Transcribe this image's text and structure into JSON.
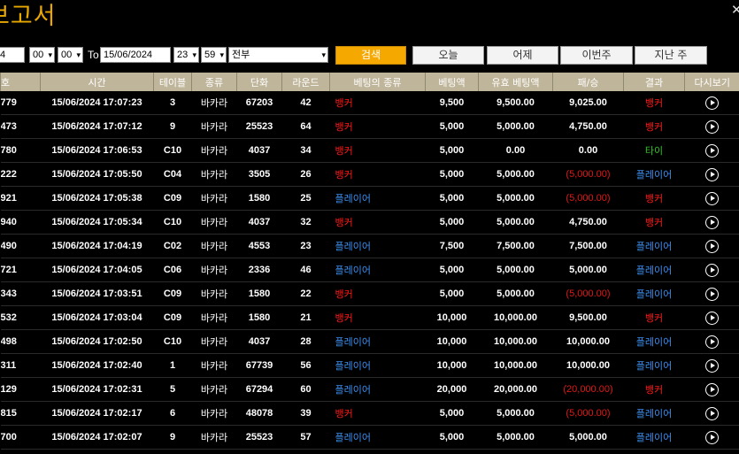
{
  "page": {
    "title": "보고서",
    "close_glyph": "✕"
  },
  "filter": {
    "from_date": "4",
    "from_hour": "00",
    "from_min": "00",
    "to_label": "To",
    "to_date": "15/06/2024",
    "to_hour": "23",
    "to_min": "59",
    "type_select": "전부",
    "search_label": "검색",
    "today_label": "오늘",
    "yesterday_label": "어제",
    "this_week_label": "이번주",
    "last_week_label": "지난 주"
  },
  "table": {
    "headers": [
      "호",
      "시간",
      "테이블",
      "종류",
      "단화",
      "라운드",
      "베팅의 종류",
      "베팅액",
      "유효 베팅액",
      "패/승",
      "결과",
      "다시보기"
    ],
    "rows": [
      {
        "id": "779",
        "time": "15/06/2024 17:07:23",
        "table": "3",
        "kind": "바카라",
        "shoe": "67203",
        "round": "42",
        "bet_type": "뱅커",
        "bet_color": "red",
        "bet": "9,500",
        "valid": "9,500.00",
        "winloss": "9,025.00",
        "winloss_neg": false,
        "result": "뱅커",
        "result_color": "red"
      },
      {
        "id": "473",
        "time": "15/06/2024 17:07:12",
        "table": "9",
        "kind": "바카라",
        "shoe": "25523",
        "round": "64",
        "bet_type": "뱅커",
        "bet_color": "red",
        "bet": "5,000",
        "valid": "5,000.00",
        "winloss": "4,750.00",
        "winloss_neg": false,
        "result": "뱅커",
        "result_color": "red"
      },
      {
        "id": "780",
        "time": "15/06/2024 17:06:53",
        "table": "C10",
        "kind": "바카라",
        "shoe": "4037",
        "round": "34",
        "bet_type": "뱅커",
        "bet_color": "red",
        "bet": "5,000",
        "valid": "0.00",
        "winloss": "0.00",
        "winloss_neg": false,
        "result": "타이",
        "result_color": "green"
      },
      {
        "id": "222",
        "time": "15/06/2024 17:05:50",
        "table": "C04",
        "kind": "바카라",
        "shoe": "3505",
        "round": "26",
        "bet_type": "뱅커",
        "bet_color": "red",
        "bet": "5,000",
        "valid": "5,000.00",
        "winloss": "(5,000.00)",
        "winloss_neg": true,
        "result": "플레이어",
        "result_color": "blue"
      },
      {
        "id": "921",
        "time": "15/06/2024 17:05:38",
        "table": "C09",
        "kind": "바카라",
        "shoe": "1580",
        "round": "25",
        "bet_type": "플레이어",
        "bet_color": "blue",
        "bet": "5,000",
        "valid": "5,000.00",
        "winloss": "(5,000.00)",
        "winloss_neg": true,
        "result": "뱅커",
        "result_color": "red"
      },
      {
        "id": "940",
        "time": "15/06/2024 17:05:34",
        "table": "C10",
        "kind": "바카라",
        "shoe": "4037",
        "round": "32",
        "bet_type": "뱅커",
        "bet_color": "red",
        "bet": "5,000",
        "valid": "5,000.00",
        "winloss": "4,750.00",
        "winloss_neg": false,
        "result": "뱅커",
        "result_color": "red"
      },
      {
        "id": "490",
        "time": "15/06/2024 17:04:19",
        "table": "C02",
        "kind": "바카라",
        "shoe": "4553",
        "round": "23",
        "bet_type": "플레이어",
        "bet_color": "blue",
        "bet": "7,500",
        "valid": "7,500.00",
        "winloss": "7,500.00",
        "winloss_neg": false,
        "result": "플레이어",
        "result_color": "blue"
      },
      {
        "id": "721",
        "time": "15/06/2024 17:04:05",
        "table": "C06",
        "kind": "바카라",
        "shoe": "2336",
        "round": "46",
        "bet_type": "플레이어",
        "bet_color": "blue",
        "bet": "5,000",
        "valid": "5,000.00",
        "winloss": "5,000.00",
        "winloss_neg": false,
        "result": "플레이어",
        "result_color": "blue"
      },
      {
        "id": "343",
        "time": "15/06/2024 17:03:51",
        "table": "C09",
        "kind": "바카라",
        "shoe": "1580",
        "round": "22",
        "bet_type": "뱅커",
        "bet_color": "red",
        "bet": "5,000",
        "valid": "5,000.00",
        "winloss": "(5,000.00)",
        "winloss_neg": true,
        "result": "플레이어",
        "result_color": "blue"
      },
      {
        "id": "532",
        "time": "15/06/2024 17:03:04",
        "table": "C09",
        "kind": "바카라",
        "shoe": "1580",
        "round": "21",
        "bet_type": "뱅커",
        "bet_color": "red",
        "bet": "10,000",
        "valid": "10,000.00",
        "winloss": "9,500.00",
        "winloss_neg": false,
        "result": "뱅커",
        "result_color": "red"
      },
      {
        "id": "498",
        "time": "15/06/2024 17:02:50",
        "table": "C10",
        "kind": "바카라",
        "shoe": "4037",
        "round": "28",
        "bet_type": "플레이어",
        "bet_color": "blue",
        "bet": "10,000",
        "valid": "10,000.00",
        "winloss": "10,000.00",
        "winloss_neg": false,
        "result": "플레이어",
        "result_color": "blue"
      },
      {
        "id": "311",
        "time": "15/06/2024 17:02:40",
        "table": "1",
        "kind": "바카라",
        "shoe": "67739",
        "round": "56",
        "bet_type": "플레이어",
        "bet_color": "blue",
        "bet": "10,000",
        "valid": "10,000.00",
        "winloss": "10,000.00",
        "winloss_neg": false,
        "result": "플레이어",
        "result_color": "blue"
      },
      {
        "id": "129",
        "time": "15/06/2024 17:02:31",
        "table": "5",
        "kind": "바카라",
        "shoe": "67294",
        "round": "60",
        "bet_type": "플레이어",
        "bet_color": "blue",
        "bet": "20,000",
        "valid": "20,000.00",
        "winloss": "(20,000.00)",
        "winloss_neg": true,
        "result": "뱅커",
        "result_color": "red"
      },
      {
        "id": "815",
        "time": "15/06/2024 17:02:17",
        "table": "6",
        "kind": "바카라",
        "shoe": "48078",
        "round": "39",
        "bet_type": "뱅커",
        "bet_color": "red",
        "bet": "5,000",
        "valid": "5,000.00",
        "winloss": "(5,000.00)",
        "winloss_neg": true,
        "result": "플레이어",
        "result_color": "blue"
      },
      {
        "id": "700",
        "time": "15/06/2024 17:02:07",
        "table": "9",
        "kind": "바카라",
        "shoe": "25523",
        "round": "57",
        "bet_type": "플레이어",
        "bet_color": "blue",
        "bet": "5,000",
        "valid": "5,000.00",
        "winloss": "5,000.00",
        "winloss_neg": false,
        "result": "플레이어",
        "result_color": "blue"
      }
    ]
  },
  "icons": {
    "replay": "play-circle-icon",
    "close": "close-icon",
    "dropdown": "chevron-down-icon"
  }
}
